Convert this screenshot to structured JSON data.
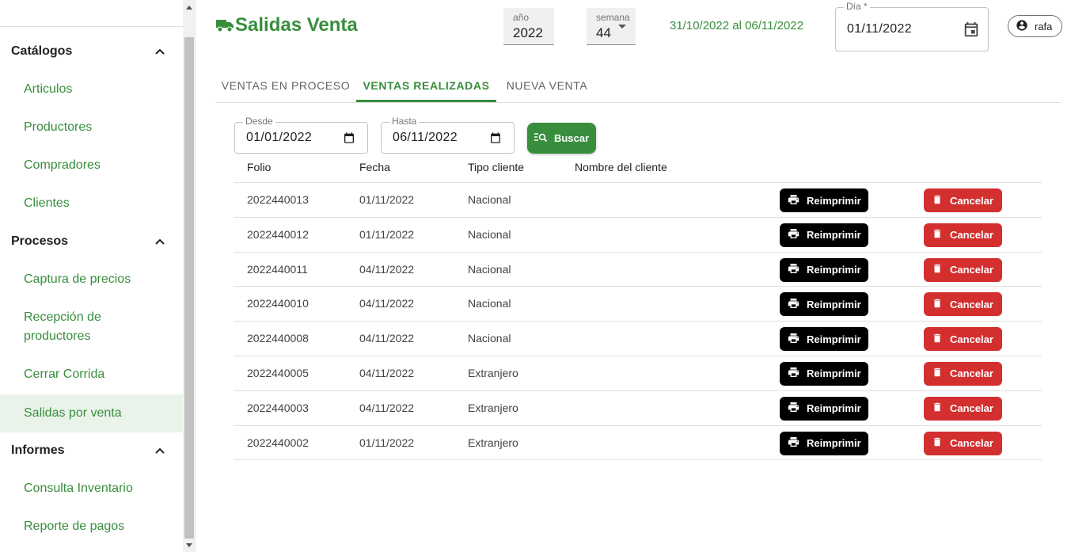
{
  "sidebar": {
    "sections": [
      {
        "title": "Catálogos",
        "items": [
          "Articulos",
          "Productores",
          "Compradores",
          "Clientes"
        ]
      },
      {
        "title": "Procesos",
        "items": [
          "Captura de precios",
          "Recepción de productores",
          "Cerrar Corrida",
          "Salidas por venta"
        ]
      },
      {
        "title": "Informes",
        "items": [
          "Consulta Inventario",
          "Reporte de pagos"
        ]
      }
    ],
    "active_item": "Salidas por venta"
  },
  "header": {
    "title": "Salidas Venta",
    "year_label": "año",
    "year_value": "2022",
    "week_label": "semana",
    "week_value": "44",
    "week_range": "31/10/2022 al 06/11/2022",
    "day_label": "Día *",
    "day_value": "01/11/2022",
    "user": "rafa"
  },
  "tabs": [
    {
      "label": "VENTAS EN PROCESO",
      "active": false
    },
    {
      "label": "VENTAS REALIZADAS",
      "active": true
    },
    {
      "label": "NUEVA VENTA",
      "active": false
    }
  ],
  "filters": {
    "desde_label": "Desde",
    "desde_value": "01/01/2022",
    "hasta_label": "Hasta",
    "hasta_value": "06/11/2022",
    "search_label": "Buscar"
  },
  "table": {
    "headers": [
      "Folio",
      "Fecha",
      "Tipo cliente",
      "Nombre del cliente"
    ],
    "reprint_label": "Reimprimir",
    "cancel_label": "Cancelar",
    "rows": [
      {
        "folio": "2022440013",
        "fecha": "01/11/2022",
        "tipo": "Nacional"
      },
      {
        "folio": "2022440012",
        "fecha": "01/11/2022",
        "tipo": "Nacional"
      },
      {
        "folio": "2022440011",
        "fecha": "04/11/2022",
        "tipo": "Nacional"
      },
      {
        "folio": "2022440010",
        "fecha": "04/11/2022",
        "tipo": "Nacional"
      },
      {
        "folio": "2022440008",
        "fecha": "04/11/2022",
        "tipo": "Nacional"
      },
      {
        "folio": "2022440005",
        "fecha": "04/11/2022",
        "tipo": "Extranjero"
      },
      {
        "folio": "2022440003",
        "fecha": "04/11/2022",
        "tipo": "Extranjero"
      },
      {
        "folio": "2022440002",
        "fecha": "01/11/2022",
        "tipo": "Extranjero"
      }
    ]
  },
  "colors": {
    "primary": "#388e3c",
    "danger": "#d32f2f",
    "reprint": "#000000"
  }
}
